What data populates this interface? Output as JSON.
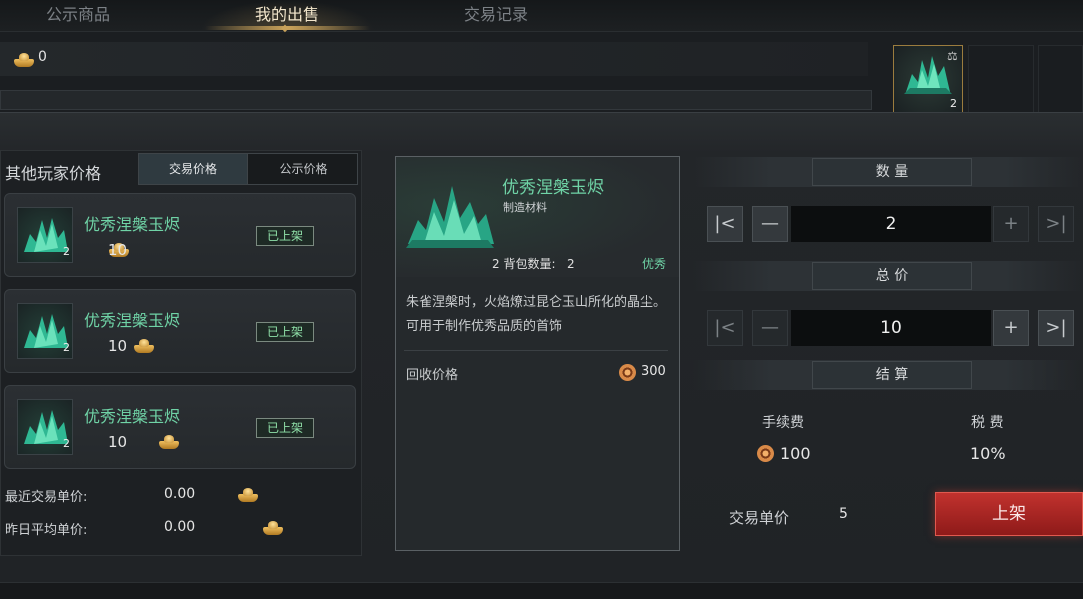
{
  "tabs": [
    {
      "label": "公示商品",
      "active": false
    },
    {
      "label": "我的出售",
      "active": true
    },
    {
      "label": "交易记录",
      "active": false
    }
  ],
  "currency": {
    "amount": "0",
    "icon": "gold-ingot-icon"
  },
  "top_slot": {
    "count": "2",
    "icon": "jade-crystal-icon"
  },
  "left_panel": {
    "title": "其他玩家价格",
    "price_tabs": [
      {
        "label": "交易价格",
        "active": true
      },
      {
        "label": "公示价格",
        "active": false
      }
    ],
    "listings": [
      {
        "name": "优秀涅槃玉烬",
        "count": "2",
        "price": "10",
        "status": "已上架"
      },
      {
        "name": "优秀涅槃玉烬",
        "count": "2",
        "price": "10",
        "status": "已上架"
      },
      {
        "name": "优秀涅槃玉烬",
        "count": "2",
        "price": "10",
        "status": "已上架"
      }
    ],
    "recent_price_label": "最近交易单价:",
    "recent_price_value": "0.00",
    "yesterday_avg_label": "昨日平均单价:",
    "yesterday_avg_value": "0.00"
  },
  "detail": {
    "name": "优秀涅槃玉烬",
    "type": "制造材料",
    "bag_qty_label": "2 背包数量:",
    "bag_qty_value": "2",
    "quality": "优秀",
    "description": "朱雀涅槃时，火焰燎过昆仑玉山所化的晶尘。可用于制作优秀品质的首饰",
    "recycle_label": "回收价格",
    "recycle_value": "300"
  },
  "quantity": {
    "title": "数 量",
    "value": "2"
  },
  "total": {
    "title": "总 价",
    "value": "10"
  },
  "settlement": {
    "title": "结 算",
    "fee_label": "手续费",
    "fee_value": "100",
    "tax_label": "税 费",
    "tax_value": "10%"
  },
  "unit_price": {
    "label": "交易单价",
    "value": "5"
  },
  "list_button": "上架",
  "icons": {
    "first": "|<",
    "minus": "—",
    "plus": "+",
    "last": ">|"
  },
  "colors": {
    "item_green": "#6fd3a6",
    "accent_gold": "#c9a25a",
    "button_red": "#b52a27"
  }
}
